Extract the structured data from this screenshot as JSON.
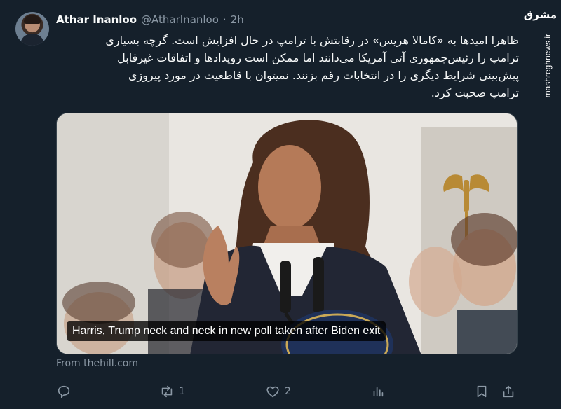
{
  "tweet": {
    "display_name": "Athar Inanloo",
    "handle": "@AtharInanloo",
    "separator": "·",
    "time": "2h",
    "text": "ظاهرا امیدها به «کامالا هریس» در رقابتش با ترامپ در حال افزایش است. گرچه بسیاری\nترامپ را رئیس‌جمهوری آتی آمریکا می‌دانند اما ممکن است رویدادها و اتفاقات غیرقابل\nپیش‌بینی شرایط دیگری را در انتخابات رقم بزنند. نمیتوان با قاطعیت در مورد پیروزی\nترامپ صحبت کرد.",
    "media_caption": "Harris, Trump neck and neck in new poll taken after Biden exit",
    "source": "From thehill.com"
  },
  "actions": {
    "reply_count": "",
    "retweet_count": "1",
    "like_count": "2",
    "views_count": ""
  },
  "icons": [
    "avatar",
    "reply-icon",
    "retweet-icon",
    "like-icon",
    "views-icon",
    "bookmark-icon",
    "share-icon"
  ],
  "watermark": {
    "logo_text": "مشرق",
    "site": "mashreghnews.ir"
  },
  "colors": {
    "background": "#15202b",
    "text_primary": "#f7f9f9",
    "text_secondary": "#8b98a5",
    "border": "#38444d"
  }
}
